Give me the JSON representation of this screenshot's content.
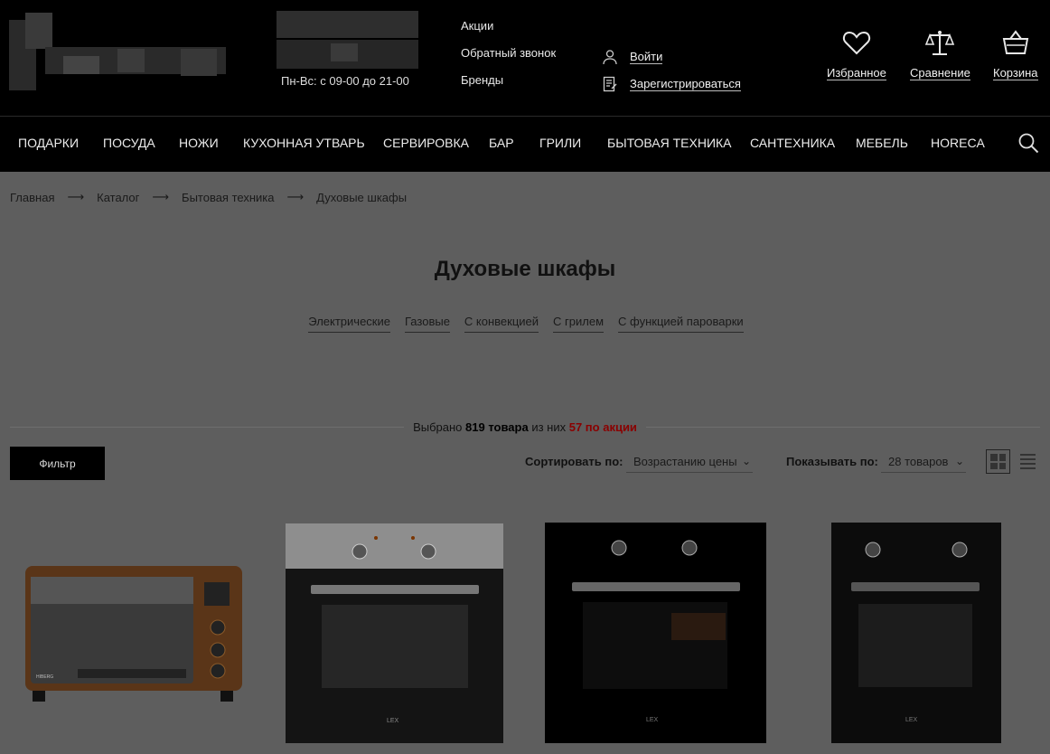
{
  "header": {
    "hours": "Пн-Вс: с 09-00 до 21-00",
    "links": [
      "Акции",
      "Обратный звонок",
      "Бренды"
    ],
    "login": "Войти",
    "register": "Зарегистрироваться",
    "favorites": "Избранное",
    "compare": "Сравнение",
    "cart": "Корзина"
  },
  "nav": [
    "ПОДАРКИ",
    "ПОСУДА",
    "НОЖИ",
    "КУХОННАЯ УТВАРЬ",
    "СЕРВИРОВКА",
    "БАР",
    "ГРИЛИ",
    "БЫТОВАЯ ТЕХНИКА",
    "САНТЕХНИКА",
    "МЕБЕЛЬ",
    "HORECA"
  ],
  "breadcrumb": [
    "Главная",
    "Каталог",
    "Бытовая техника",
    "Духовые шкафы"
  ],
  "page_title": "Духовые шкафы",
  "filters": [
    "Электрические",
    "Газовые",
    "С конвекцией",
    "С грилем",
    "С функцией пароварки"
  ],
  "count": {
    "prefix": "Выбрано",
    "total": "819 товара",
    "middle": "из них",
    "promo": "57 по акции"
  },
  "filter_button": "Фильтр",
  "sort": {
    "label": "Сортировать по:",
    "value": "Возрастанию цены"
  },
  "show": {
    "label": "Показывать по:",
    "value": "28 товаров"
  },
  "products": [
    {
      "brand": "HIBERG"
    },
    {
      "brand": "LEX"
    },
    {
      "brand": "LEX"
    },
    {
      "brand": "LEX"
    }
  ]
}
